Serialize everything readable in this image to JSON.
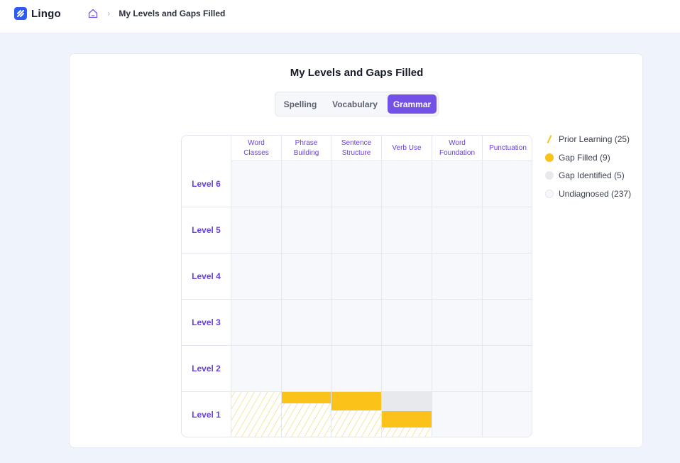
{
  "app": {
    "name": "Lingo"
  },
  "breadcrumb": {
    "current": "My Levels and Gaps Filled"
  },
  "page": {
    "title": "My Levels and Gaps Filled"
  },
  "tabs": [
    {
      "label": "Spelling",
      "active": false
    },
    {
      "label": "Vocabulary",
      "active": false
    },
    {
      "label": "Grammar",
      "active": true
    }
  ],
  "grid": {
    "columns": [
      {
        "label": "Word\nClasses"
      },
      {
        "label": "Phrase\nBuilding"
      },
      {
        "label": "Sentence\nStructure"
      },
      {
        "label": "Verb Use"
      },
      {
        "label": "Word\nFoundation"
      },
      {
        "label": "Punctuation"
      }
    ],
    "rows": [
      "Level 6",
      "Level 5",
      "Level 4",
      "Level 3",
      "Level 2",
      "Level 1"
    ],
    "level1_cells": [
      {
        "prior_learning": true,
        "gap_identified": 0,
        "gap_filled": 0
      },
      {
        "prior_learning": true,
        "gap_identified": 0,
        "gap_filled": 0.25
      },
      {
        "prior_learning": true,
        "gap_identified": 0,
        "gap_filled": 0.4
      },
      {
        "prior_learning": true,
        "gap_identified": 0.42,
        "gap_filled": 0.35
      },
      {
        "prior_learning": false,
        "gap_identified": 0,
        "gap_filled": 0
      },
      {
        "prior_learning": false,
        "gap_identified": 0,
        "gap_filled": 0
      }
    ]
  },
  "legend": [
    {
      "label": "Prior Learning (25)",
      "color": "#fbc21a",
      "style": "slash"
    },
    {
      "label": "Gap Filled (9)",
      "color": "#fbc21a",
      "style": "dot"
    },
    {
      "label": "Gap Identified (5)",
      "color": "#e8e9ed",
      "style": "dot"
    },
    {
      "label": "Undiagnosed (237)",
      "color": "#f7f8fb",
      "style": "dot"
    }
  ],
  "colors": {
    "accent": "#7351e7",
    "brand": "#2f5bf5",
    "gap_filled": "#fbc21a",
    "gap_identified": "#e8e9ed"
  }
}
